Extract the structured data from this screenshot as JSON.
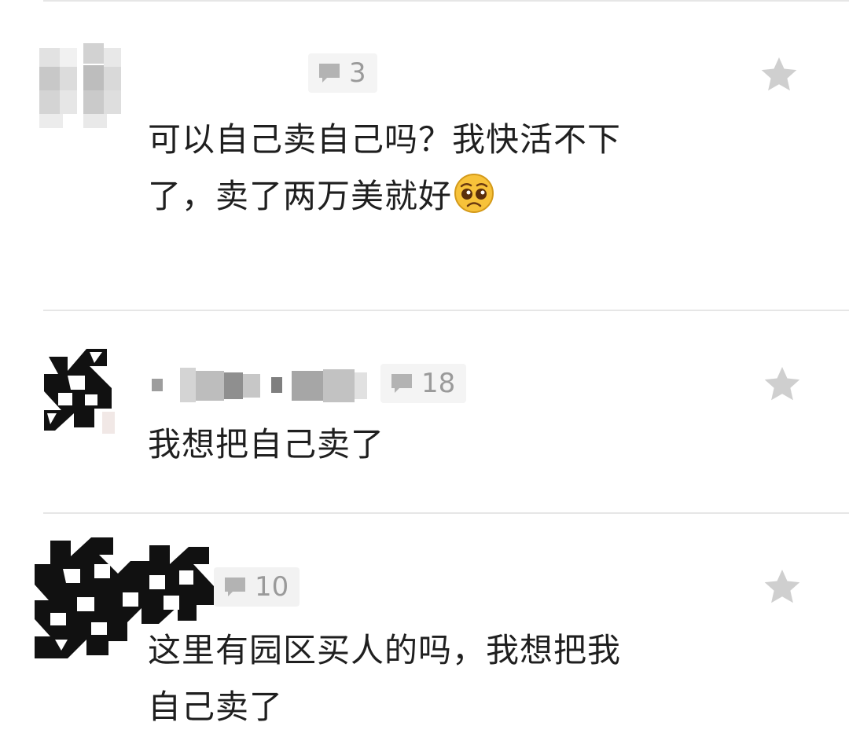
{
  "comments": [
    {
      "reply_count": "3",
      "text_line1": "可以自己卖自己吗？我快活不下",
      "text_line2": "了，卖了两万美就好",
      "emoji": "pleading-face-icon"
    },
    {
      "reply_count": "18",
      "text_line1": "我想把自己卖了"
    },
    {
      "reply_count": "10",
      "text_line1": "这里有园区买人的吗，我想把我",
      "text_line2": "自己卖了"
    }
  ],
  "icons": {
    "reply": "comment-bubble-icon",
    "favorite": "star-icon"
  },
  "colors": {
    "star": "#cfcfcf",
    "chip_bg": "#f4f4f4",
    "count": "#9a9a9a",
    "divider": "#e6e6e6"
  }
}
